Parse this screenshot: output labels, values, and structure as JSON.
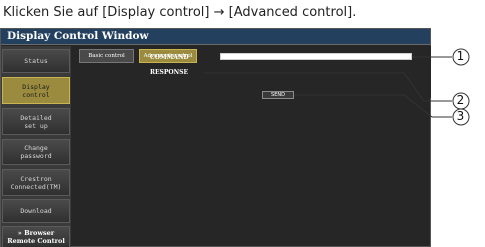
{
  "instruction": "Klicken Sie auf [Display control] → [Advanced control].",
  "window": {
    "title": "Display Control Window"
  },
  "sidebar": {
    "items": [
      {
        "label": "Status"
      },
      {
        "label": "Display\ncontrol",
        "active": true
      },
      {
        "label": "Detailed\nset up"
      },
      {
        "label": "Change\npassword"
      },
      {
        "label": "Crestron\nConnected(TM)"
      },
      {
        "label": "Download"
      },
      {
        "label": "» Browser\nRemote Control"
      }
    ]
  },
  "tabs": {
    "basic": "Basic control",
    "advanced": "Advanced control"
  },
  "form": {
    "command_label": "COMMAND",
    "command_value": "",
    "response_label": "RESPONSE",
    "send_label": "SEND"
  },
  "callouts": [
    "1",
    "2",
    "3"
  ],
  "colors": {
    "titlebar": "#23405e",
    "active": "#9a8b3e",
    "panel": "#262626"
  }
}
